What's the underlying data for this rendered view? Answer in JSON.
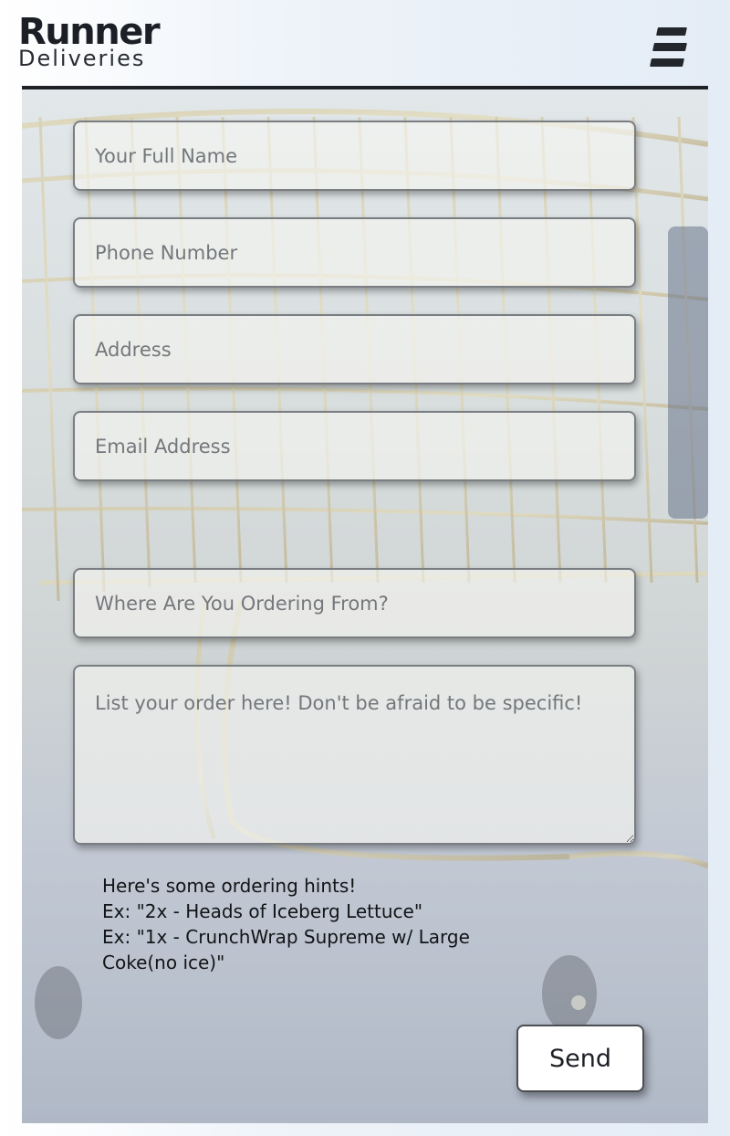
{
  "brand": {
    "name": "Runner",
    "tagline": "Deliveries"
  },
  "header": {
    "menu_icon": "hamburger-menu-icon"
  },
  "form": {
    "full_name": {
      "placeholder": "Your Full Name",
      "value": ""
    },
    "phone": {
      "placeholder": "Phone Number",
      "value": ""
    },
    "address": {
      "placeholder": "Address",
      "value": ""
    },
    "email": {
      "placeholder": "Email Address",
      "value": ""
    },
    "store": {
      "placeholder": "Where Are You Ordering From?",
      "value": ""
    },
    "order": {
      "placeholder": "List your order here! Don't be afraid to be specific!",
      "value": ""
    },
    "hints": {
      "title": "Here's some ordering hints!",
      "example_1": "Ex: \"2x - Heads of Iceberg Lettuce\"",
      "example_2": "Ex: \"1x - CrunchWrap Supreme w/ Large Coke(no ice)\""
    },
    "send_label": "Send"
  },
  "colors": {
    "brand_text": "#1c1f25",
    "field_border": "#7a7d82",
    "placeholder": "#74777b",
    "background_accent": "#e4ecf6"
  }
}
